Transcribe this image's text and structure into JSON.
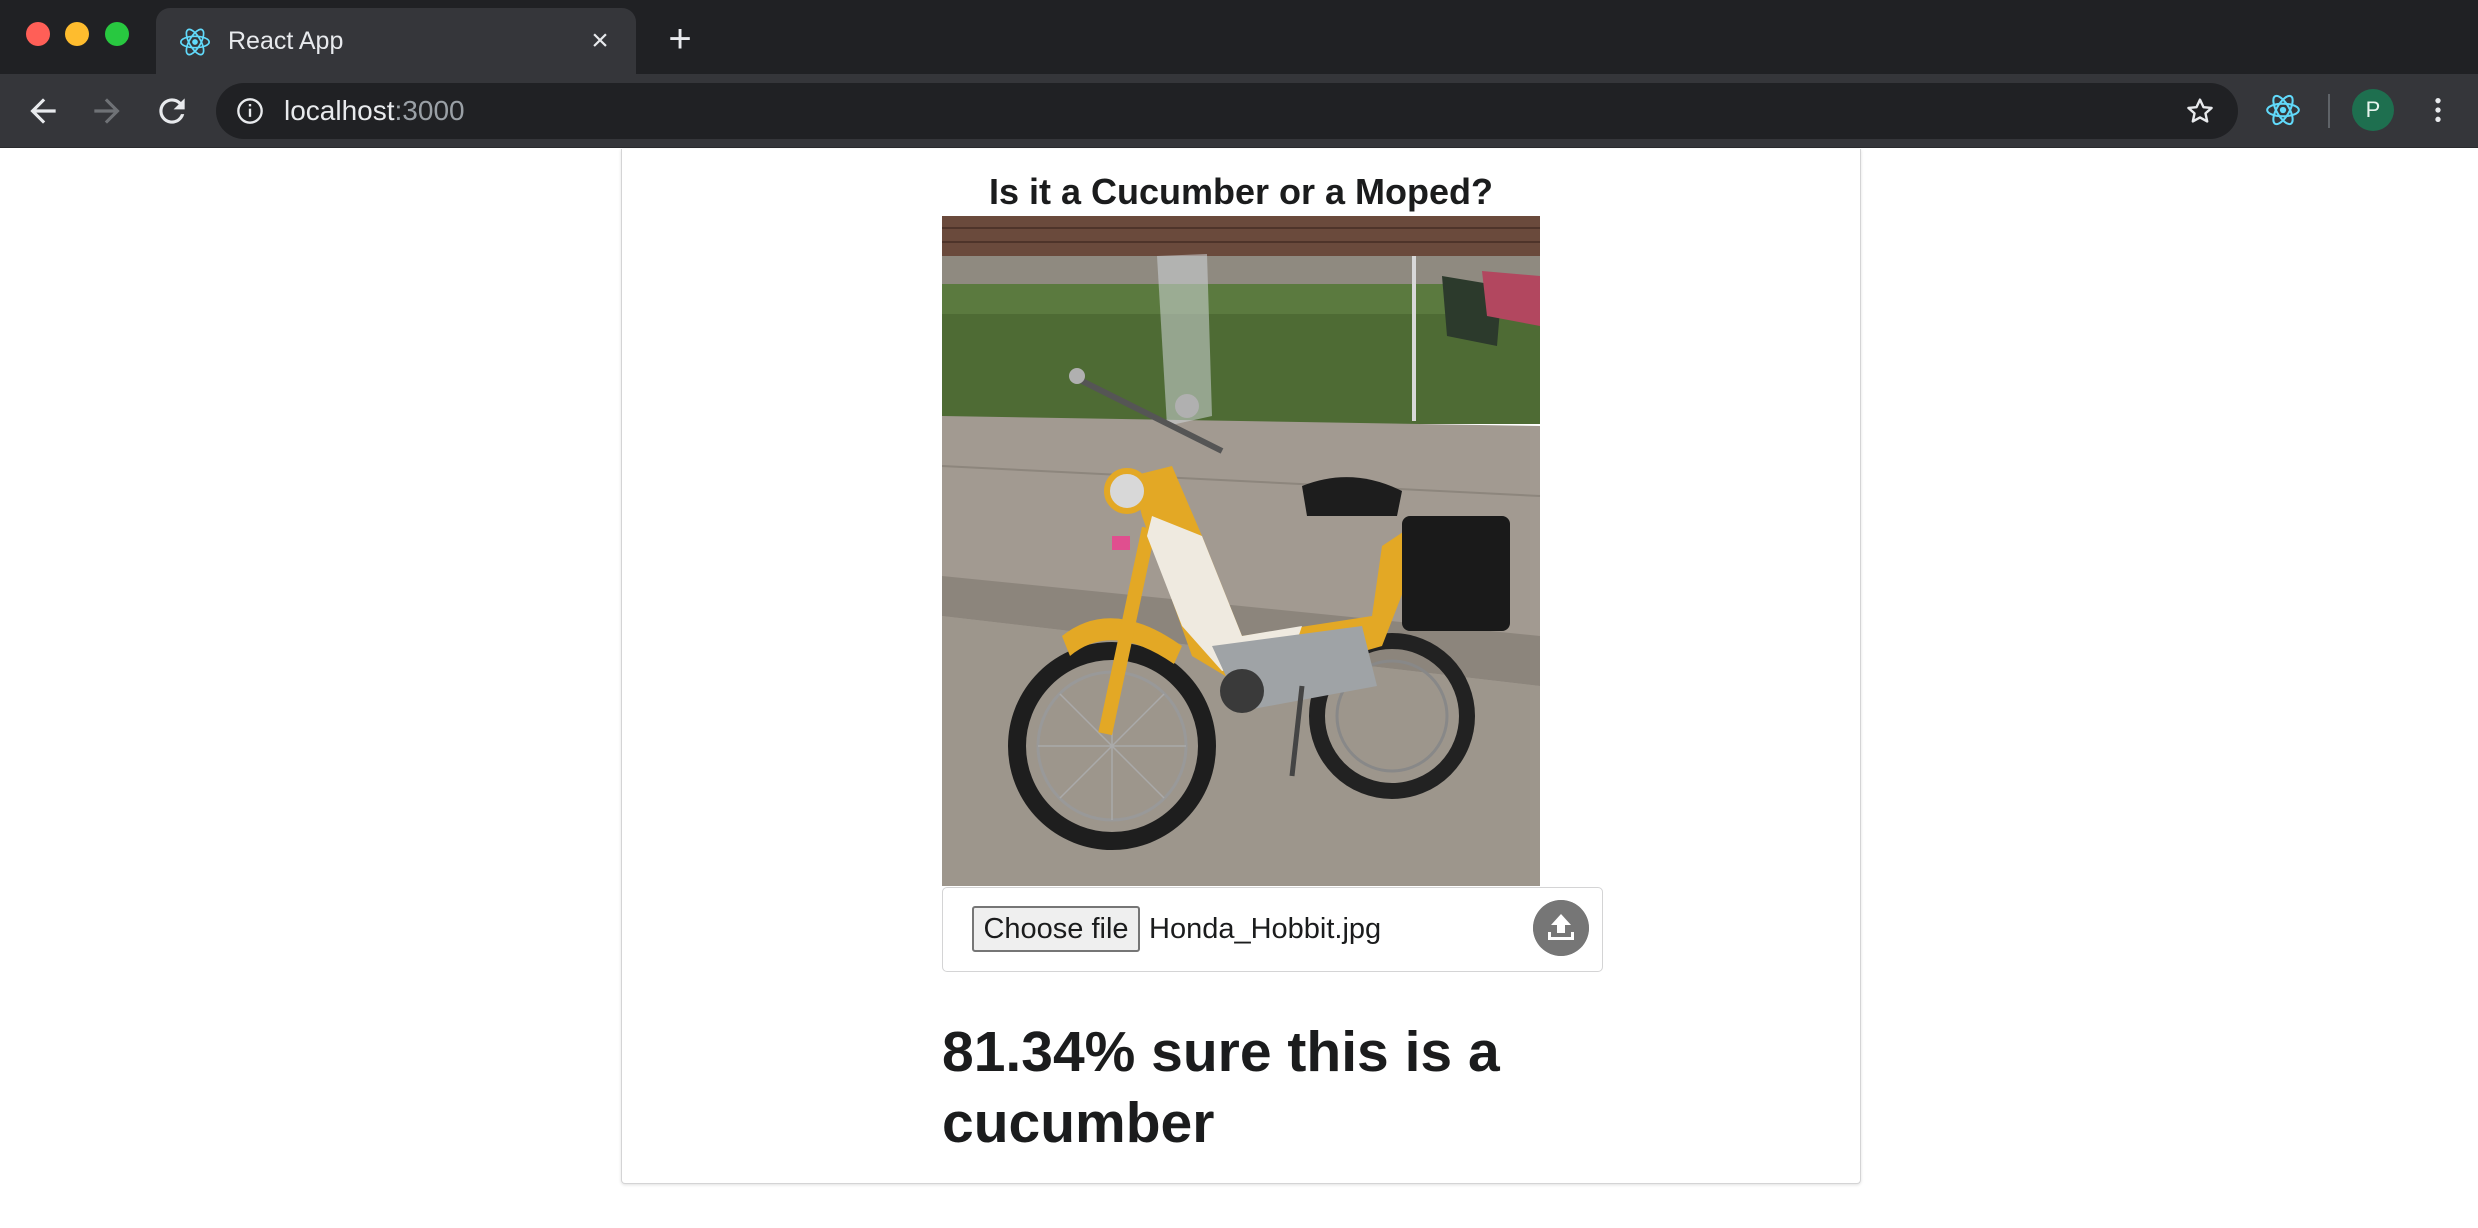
{
  "browser": {
    "tab_title": "React App",
    "tab_close_glyph": "×",
    "new_tab_glyph": "+",
    "url_host": "localhost",
    "url_port": ":3000",
    "profile_initial": "P",
    "icons": [
      "back-arrow-icon",
      "forward-arrow-icon",
      "reload-icon",
      "info-icon",
      "star-icon",
      "react-devtools-icon",
      "menu-icon"
    ]
  },
  "app": {
    "title": "Is it a Cucumber or a Moped?",
    "image_alt": "Yellow Honda moped parked on a sidewalk",
    "upload": {
      "choose_label": "Choose file",
      "file_name": "Honda_Hobbit.jpg",
      "upload_icon": "upload-icon"
    },
    "result": "81.34% sure this is a cucumber"
  },
  "colors": {
    "tabbar_bg": "#202124",
    "toolbar_bg": "#35363a",
    "text_dark": "#1b1c1d",
    "upload_button_bg": "#767676",
    "avatar_bg": "#1e6f4f"
  }
}
